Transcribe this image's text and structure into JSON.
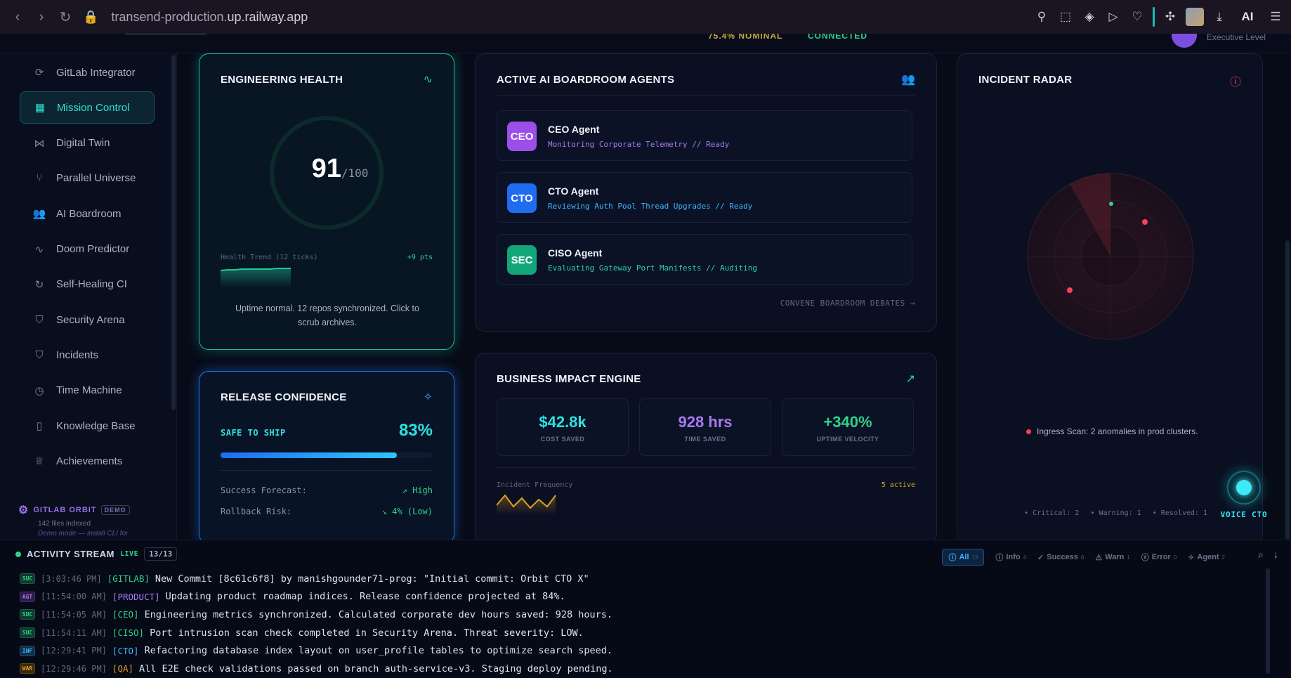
{
  "browser": {
    "url_main": "transend-production.",
    "url_rest": "up.railway.app",
    "ai_label": "AI"
  },
  "topstrip": {
    "status_a": "75.4% NOMINAL",
    "status_b": "CONNECTED",
    "user_level": "Executive Level"
  },
  "sidebar": {
    "items": [
      {
        "label": "GitLab Integrator",
        "icon": "link-icon"
      },
      {
        "label": "Mission Control",
        "icon": "grid-icon",
        "active": true
      },
      {
        "label": "Digital Twin",
        "icon": "share-icon"
      },
      {
        "label": "Parallel Universe",
        "icon": "branch-icon"
      },
      {
        "label": "AI Boardroom",
        "icon": "users-icon"
      },
      {
        "label": "Doom Predictor",
        "icon": "activity-icon"
      },
      {
        "label": "Self-Healing CI",
        "icon": "refresh-icon"
      },
      {
        "label": "Security Arena",
        "icon": "shield-check-icon"
      },
      {
        "label": "Incidents",
        "icon": "shield-alert-icon"
      },
      {
        "label": "Time Machine",
        "icon": "clock-icon"
      },
      {
        "label": "Knowledge Base",
        "icon": "book-icon"
      },
      {
        "label": "Achievements",
        "icon": "trophy-icon"
      }
    ],
    "orbit": {
      "title": "GITLAB ORBIT",
      "badge": "DEMO",
      "files": "142 files indexed",
      "hint": "Demo mode — install CLI for"
    }
  },
  "engineering": {
    "title": "ENGINEERING HEALTH",
    "score": "91",
    "out_of": "/100",
    "score_value": 91,
    "trend_label": "Health Trend (12 ticks)",
    "trend_delta": "+9 pts",
    "note": "Uptime normal. 12 repos synchronized. Click to scrub archives."
  },
  "release": {
    "title": "RELEASE CONFIDENCE",
    "status": "SAFE TO SHIP",
    "percent": "83%",
    "percent_value": 83,
    "forecast_label": "Success Forecast:",
    "forecast_value": "High",
    "risk_label": "Rollback Risk:",
    "risk_value": "4% (Low)"
  },
  "agents": {
    "title": "ACTIVE AI BOARDROOM AGENTS",
    "list": [
      {
        "badge": "CEO",
        "name": "CEO Agent",
        "desc": "Monitoring Corporate Telemetry // Ready",
        "color": "#9b4ee8",
        "desc_color": "#a77af0"
      },
      {
        "badge": "CTO",
        "name": "CTO Agent",
        "desc": "Reviewing Auth Pool Thread Upgrades // Ready",
        "color": "#1f6cf0",
        "desc_color": "#3fb4ff"
      },
      {
        "badge": "SEC",
        "name": "CISO Agent",
        "desc": "Evaluating Gateway Port Manifests // Auditing",
        "color": "#12a579",
        "desc_color": "#2ed3a0"
      }
    ],
    "convene": "CONVENE BOARDROOM DEBATES →"
  },
  "business": {
    "title": "BUSINESS IMPACT ENGINE",
    "metrics": [
      {
        "value": "$42.8k",
        "label": "COST SAVED",
        "color": "#2ee0e0"
      },
      {
        "value": "928 hrs",
        "label": "TIME SAVED",
        "color": "#a77af0"
      },
      {
        "value": "+340%",
        "label": "UPTIME VELOCITY",
        "color": "#2ed389"
      }
    ],
    "freq_label": "Incident Frequency",
    "freq_active": "5 active"
  },
  "radar": {
    "title": "INCIDENT RADAR",
    "scan": "Ingress Scan: 2 anomalies in prod clusters.",
    "legend_critical": "Critical: 2",
    "legend_warning": "Warning: 1",
    "legend_resolved": "Resolved: 1"
  },
  "voice": {
    "label": "VOICE CTO"
  },
  "stream": {
    "title": "ACTIVITY STREAM",
    "live": "LIVE",
    "count": "13/13",
    "filters": [
      {
        "label": "All",
        "count": "13",
        "active": true
      },
      {
        "label": "Info",
        "count": "4"
      },
      {
        "label": "Success",
        "count": "6"
      },
      {
        "label": "Warn",
        "count": "1"
      },
      {
        "label": "Error",
        "count": "0"
      },
      {
        "label": "Agent",
        "count": "2"
      }
    ],
    "rows": [
      {
        "level": "SUC",
        "cls": "suc",
        "time": "[3:03:46 PM]",
        "tag": "[GITLAB]",
        "tag_color": "#2ed389",
        "msg": "New Commit [8c61c6f8] by manishgounder71-prog: \"Initial commit: Orbit CTO X\""
      },
      {
        "level": "AGT",
        "cls": "agt",
        "time": "[11:54:00 AM]",
        "tag": "[PRODUCT]",
        "tag_color": "#a77af0",
        "msg": "Updating product roadmap indices. Release confidence projected at 84%."
      },
      {
        "level": "SUC",
        "cls": "suc",
        "time": "[11:54:05 AM]",
        "tag": "[CEO]",
        "tag_color": "#2ed389",
        "msg": "Engineering metrics synchronized. Calculated corporate dev hours saved: 928 hours."
      },
      {
        "level": "SUC",
        "cls": "suc",
        "time": "[11:54:11 AM]",
        "tag": "[CISO]",
        "tag_color": "#2ed389",
        "msg": "Port intrusion scan check completed in Security Arena. Threat severity: LOW."
      },
      {
        "level": "INF",
        "cls": "inf",
        "time": "[12:29:41 PM]",
        "tag": "[CTO]",
        "tag_color": "#3fb4ff",
        "msg": "Refactoring database index layout on user_profile tables to optimize search speed."
      },
      {
        "level": "WAR",
        "cls": "war",
        "time": "[12:29:46 PM]",
        "tag": "[QA]",
        "tag_color": "#e0a020",
        "msg": "All E2E check validations passed on branch auth-service-v3. Staging deploy pending."
      }
    ]
  }
}
